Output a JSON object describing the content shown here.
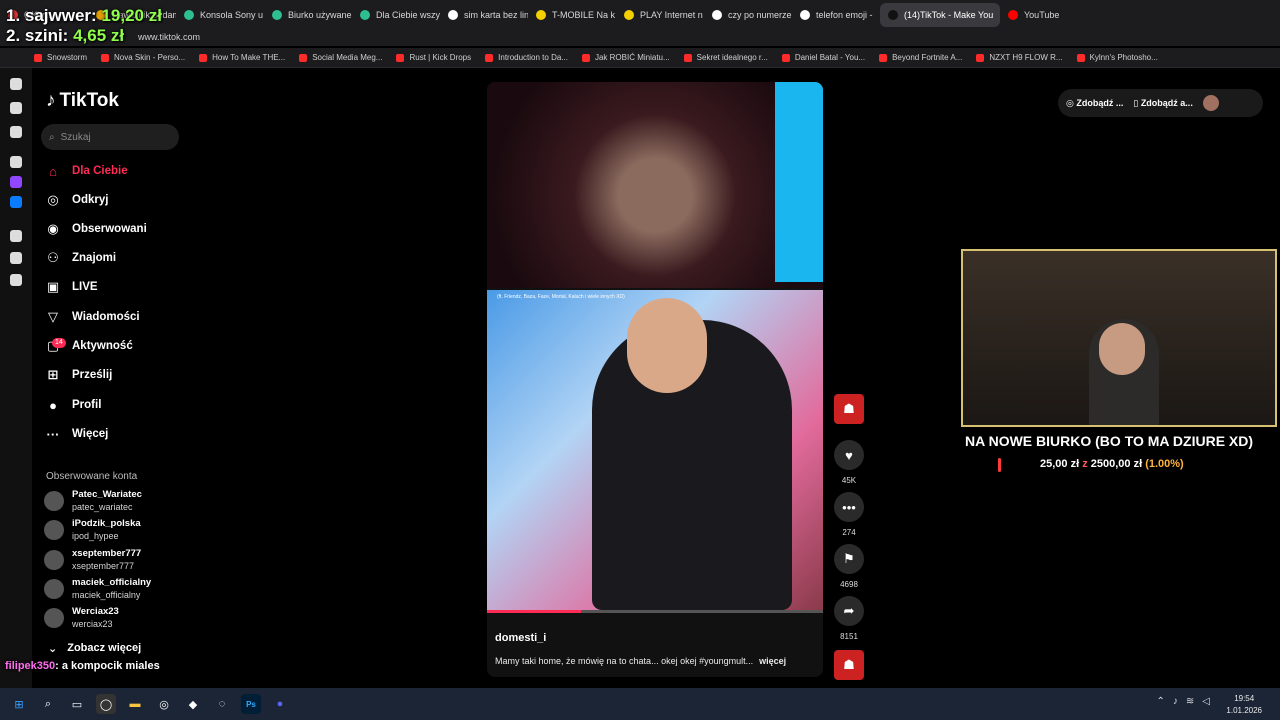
{
  "browser": {
    "tabs": [
      {
        "label": "6 Kart...",
        "color": "#d33"
      },
      {
        "label": "Nawilżnik oddam",
        "color": "#e4a000"
      },
      {
        "label": "Konsola Sony u",
        "color": "#2fbf8e"
      },
      {
        "label": "Biurko używane",
        "color": "#2fbf8e"
      },
      {
        "label": "Dla Ciebie wszy",
        "color": "#2fbf8e"
      },
      {
        "label": "sim karta bez lin",
        "color": "#ffffff"
      },
      {
        "label": "T-MOBILE Na k",
        "color": "#f5d000"
      },
      {
        "label": "PLAY Internet n",
        "color": "#f5d000"
      },
      {
        "label": "czy po numerze",
        "color": "#ffffff"
      },
      {
        "label": "telefon emoji -",
        "color": "#ffffff"
      },
      {
        "label": "(14)TikTok - Make You",
        "color": "#111111",
        "active": true
      },
      {
        "label": "YouTube",
        "color": "#ff0000"
      }
    ],
    "url": "www.tiktok.com",
    "bookmarks": [
      "Snowstorm",
      "Nova Skin - Perso...",
      "How To Make THE...",
      "Social Media Meg...",
      "Rust | Kick Drops",
      "Introduction to Da...",
      "Jak ROBIĆ Miniatu...",
      "Sekret idealnego r...",
      "Daniel Batal - You...",
      "Beyond Fortnite A...",
      "NZXT H9 FLOW R...",
      "Kylnn's Photosho..."
    ]
  },
  "overlay": {
    "rank1": "1. sajwwer:",
    "rank1_value": "19,20 zł",
    "rank2": "2. szini:",
    "rank2_value": "4,65 zł",
    "chat_user": "filipek350",
    "chat_message": ": a kompocik miales"
  },
  "tiktok": {
    "logo": "TikTok",
    "search_placeholder": "Szukaj",
    "nav": [
      {
        "label": "Dla Ciebie",
        "icon": "⌂"
      },
      {
        "label": "Odkryj",
        "icon": "◎"
      },
      {
        "label": "Obserwowani",
        "icon": "◉"
      },
      {
        "label": "Znajomi",
        "icon": "⚇"
      },
      {
        "label": "LIVE",
        "icon": "▣"
      },
      {
        "label": "Wiadomości",
        "icon": "▽"
      },
      {
        "label": "Aktywność",
        "icon": "▢"
      },
      {
        "label": "Prześlij",
        "icon": "⊞"
      },
      {
        "label": "Profil",
        "icon": "●"
      },
      {
        "label": "Więcej",
        "icon": "···"
      }
    ],
    "notification_count": "14",
    "following_title": "Obserwowane konta",
    "accounts": [
      {
        "name": "Patec_Wariatec",
        "handle": "patec_wariatec"
      },
      {
        "name": "iPodzik_polska",
        "handle": "ipod_hypee"
      },
      {
        "name": "xseptember777",
        "handle": "xseptember777"
      },
      {
        "name": "maciek_officialny",
        "handle": "maciek_officialny"
      },
      {
        "name": "Werciax23",
        "handle": "werciax23"
      }
    ],
    "see_more": "Zobacz więcej",
    "video": {
      "caption_overlay": "(ft. Friendz, Baza, Faze, Mortal, Kaluch i wiele innych XD)",
      "author": "domesti_i",
      "description": "Mamy taki home, że mówię na to chata... okej okej #youngmult...",
      "more": "więcej",
      "progress": 0.28
    },
    "actions": [
      {
        "icon": "♥",
        "count": "45K"
      },
      {
        "icon": "•••",
        "count": "274"
      },
      {
        "icon": "⚑",
        "count": "4698"
      },
      {
        "icon": "➦",
        "count": "8151"
      }
    ],
    "top_right": [
      "Zdobądź ...",
      "Zdobądź a..."
    ]
  },
  "stream_goal": {
    "title": "NA NOWE BIURKO (BO TO MA DZIURE XD)",
    "current": "25,00 zł",
    "separator": "z",
    "target": "2500,00 zł",
    "percent": "(1.00%)"
  },
  "taskbar": {
    "time": "19:54",
    "date": "1.01.2026"
  }
}
